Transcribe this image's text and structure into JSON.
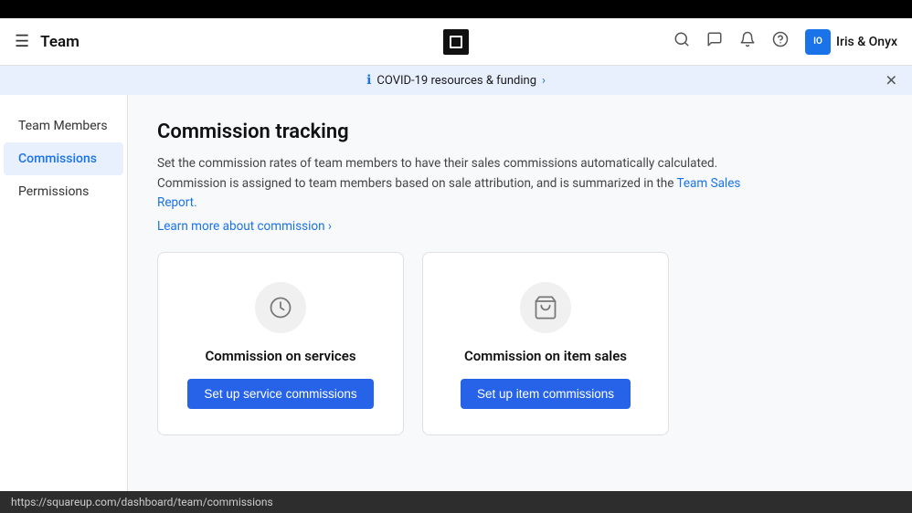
{
  "topbar": {},
  "header": {
    "menu_icon": "☰",
    "title": "Team",
    "logo_alt": "Square logo",
    "icons": {
      "search": "🔍",
      "chat": "💬",
      "bell": "🔔",
      "help": "❓"
    },
    "user": {
      "name": "Iris & Onyx",
      "avatar_text": "IO"
    }
  },
  "banner": {
    "info_icon": "ℹ",
    "text": "COVID-19 resources & funding",
    "link_suffix": "›",
    "close": "✕"
  },
  "sidebar": {
    "items": [
      {
        "id": "team-members",
        "label": "Team Members",
        "active": false
      },
      {
        "id": "commissions",
        "label": "Commissions",
        "active": true
      },
      {
        "id": "permissions",
        "label": "Permissions",
        "active": false
      }
    ]
  },
  "main": {
    "title": "Commission tracking",
    "description": "Set the commission rates of team members to have their sales commissions automatically calculated. Commission is assigned to team members based on sale attribution, and is summarized in the",
    "description_link": "Team Sales Report.",
    "learn_more": "Learn more about commission ›",
    "cards": [
      {
        "id": "services",
        "icon_type": "clock",
        "title": "Commission on services",
        "button_label": "Set up service commissions"
      },
      {
        "id": "items",
        "icon_type": "bag",
        "title": "Commission on item sales",
        "button_label": "Set up item commissions"
      }
    ]
  },
  "statusbar": {
    "url": "https://squareup.com/dashboard/team/commissions"
  }
}
